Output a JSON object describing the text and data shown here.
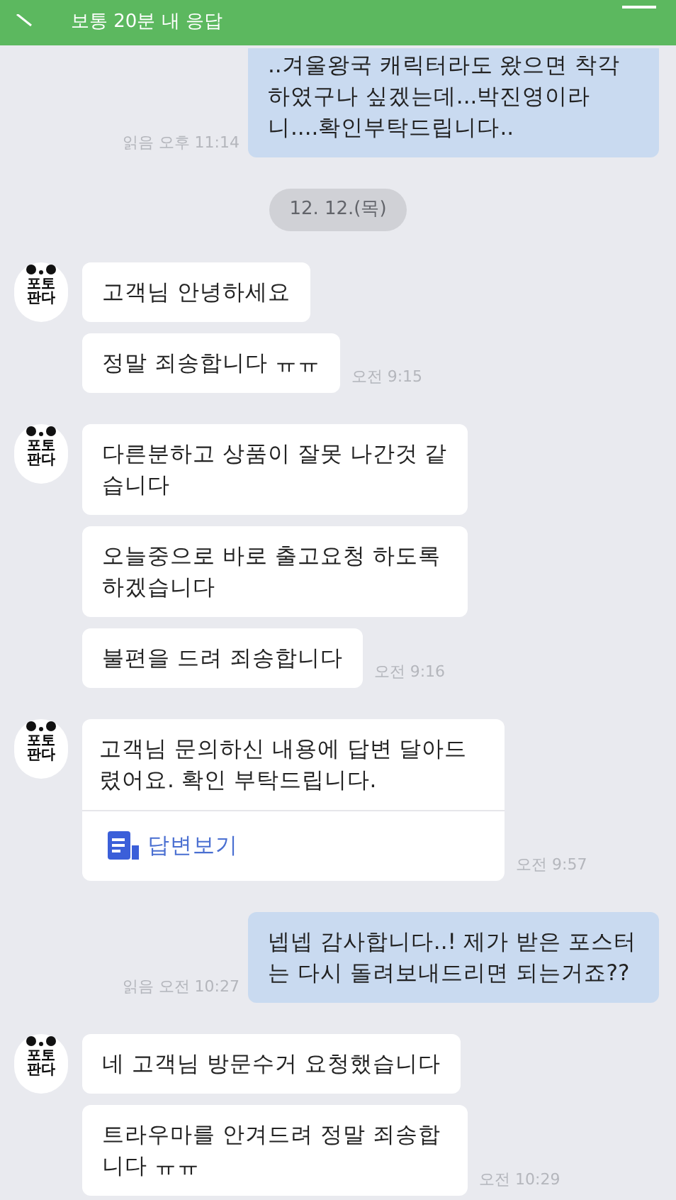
{
  "header": {
    "subtitle": "보통 20분 내 응답"
  },
  "messages": [
    {
      "kind": "outgoing",
      "bubbles": [
        "..겨울왕국 캐릭터라도 왔으면 착각하였구나 싶겠는데...박진영이라니....확인부탁드립니다.."
      ],
      "read_label": "읽음",
      "time": "오후 11:14",
      "clipped": true
    },
    {
      "kind": "date",
      "text": "12. 12.(목)"
    },
    {
      "kind": "incoming",
      "avatar": [
        "포토",
        "판다"
      ],
      "bubbles": [
        "고객님 안녕하세요",
        "정말 죄송합니다 ㅠㅠ"
      ],
      "time": "오전 9:15"
    },
    {
      "kind": "incoming",
      "avatar": [
        "포토",
        "판다"
      ],
      "bubbles": [
        "다른분하고 상품이 잘못 나간것 같습니다",
        "오늘중으로 바로 출고요청 하도록하겠습니다",
        "불편을 드려 죄송합니다"
      ],
      "time": "오전 9:16"
    },
    {
      "kind": "incoming",
      "avatar": [
        "포토",
        "판다"
      ],
      "bubbles": [
        "고객님 문의하신 내용에 답변 달아드렸어요. 확인 부탁드립니다."
      ],
      "link": "답변보기",
      "time": "오전 9:57"
    },
    {
      "kind": "outgoing",
      "bubbles": [
        "넵넵 감사합니다..! 제가 받은 포스터는 다시 돌려보내드리면 되는거죠??"
      ],
      "read_label": "읽음",
      "time": "오전 10:27",
      "clipped": false
    },
    {
      "kind": "incoming",
      "avatar": [
        "포토",
        "판다"
      ],
      "bubbles": [
        "네 고객님 방문수거 요청했습니다",
        "트라우마를 안겨드려 정말 죄송합니다 ㅠㅠ"
      ],
      "time": "오전 10:29"
    }
  ]
}
